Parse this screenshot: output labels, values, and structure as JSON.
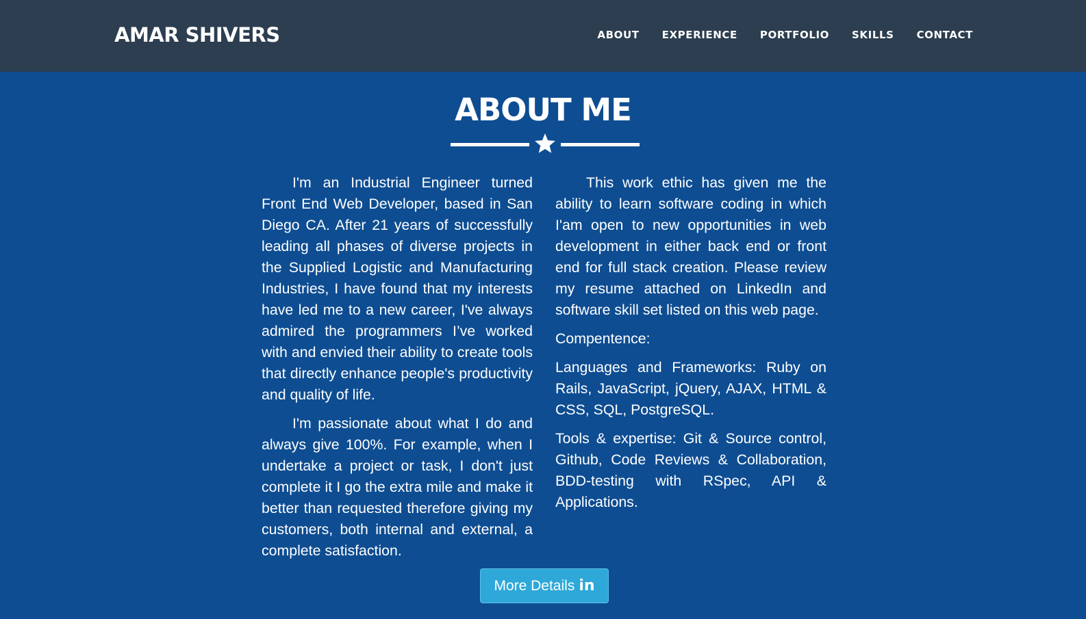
{
  "header": {
    "brand": "AMAR SHIVERS",
    "nav": [
      {
        "label": "ABOUT"
      },
      {
        "label": "EXPERIENCE"
      },
      {
        "label": "PORTFOLIO"
      },
      {
        "label": "SKILLS"
      },
      {
        "label": "CONTACT"
      }
    ]
  },
  "about": {
    "title": "ABOUT ME",
    "left_paragraphs": [
      "I'm an Industrial Engineer turned Front End Web Developer, based in San Diego CA. After 21 years of successfully leading all phases of diverse projects in the Supplied Logistic and Manufacturing Industries, I have found that my interests have led me to a new career, I've always admired the programmers I’ve worked with and envied their ability to create tools that directly enhance people's productivity and quality of life.",
      "I'm passionate about what I do and always give 100%. For example, when I undertake a project or task, I don't just complete it I go the extra mile and make it better than requested therefore giving my customers, both internal and external, a complete satisfaction."
    ],
    "right_paragraphs": [
      "This work ethic has given me the ability to learn software coding in which I'am open to new opportunities in web development in either back end or front end for full stack creation. Please review my resume attached on LinkedIn and software skill set listed on this web page.",
      "Compentence:",
      "Languages and Frameworks: Ruby on Rails, JavaScript, jQuery, AJAX, HTML & CSS, SQL, PostgreSQL.",
      "Tools & expertise: Git & Source control, Github, Code Reviews & Collaboration, BDD-testing with RSpec, API & Applications."
    ],
    "button_label": "More Details",
    "button_icon": "linkedin-icon",
    "button_icon_text": "in"
  },
  "colors": {
    "navbar_bg": "#2c3e50",
    "section_bg": "#0e4d92",
    "button_bg": "#2ea8d9",
    "text": "#ffffff"
  }
}
